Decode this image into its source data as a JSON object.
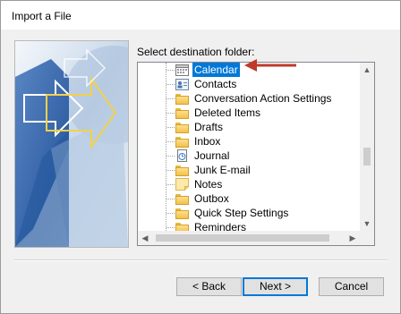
{
  "window": {
    "title": "Import a File"
  },
  "select_label": "Select destination folder:",
  "folders": [
    {
      "label": "Calendar",
      "icon": "calendar-icon",
      "selected": true
    },
    {
      "label": "Contacts",
      "icon": "contacts-icon",
      "selected": false
    },
    {
      "label": "Conversation Action Settings",
      "icon": "folder-icon",
      "selected": false
    },
    {
      "label": "Deleted Items",
      "icon": "folder-icon",
      "selected": false
    },
    {
      "label": "Drafts",
      "icon": "folder-icon",
      "selected": false
    },
    {
      "label": "Inbox",
      "icon": "folder-icon",
      "selected": false
    },
    {
      "label": "Journal",
      "icon": "journal-icon",
      "selected": false
    },
    {
      "label": "Junk E-mail",
      "icon": "folder-icon",
      "selected": false
    },
    {
      "label": "Notes",
      "icon": "notes-icon",
      "selected": false
    },
    {
      "label": "Outbox",
      "icon": "folder-icon",
      "selected": false
    },
    {
      "label": "Quick Step Settings",
      "icon": "folder-icon",
      "selected": false
    },
    {
      "label": "Reminders",
      "icon": "folder-icon",
      "selected": false
    }
  ],
  "buttons": {
    "back": "< Back",
    "next": "Next >",
    "cancel": "Cancel"
  },
  "colors": {
    "selection": "#0078d7",
    "annotation_arrow": "#c0392b",
    "folder": "#f2c14b"
  }
}
